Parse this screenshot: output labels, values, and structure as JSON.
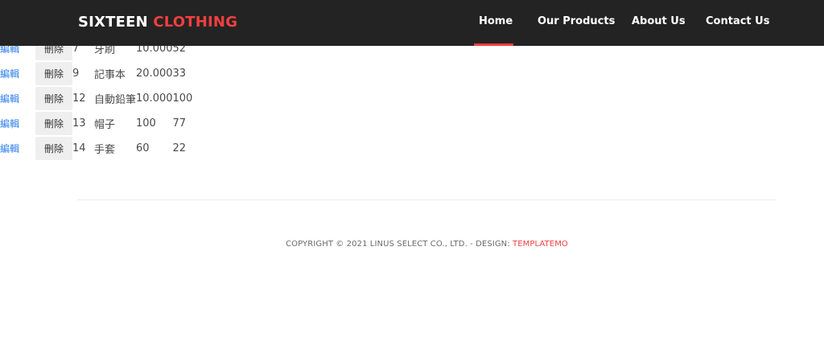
{
  "header": {
    "brand_part1": "SIXTEEN",
    "brand_part2": "CLOTHING",
    "nav": [
      {
        "label": "Home"
      },
      {
        "label": "Our Products"
      },
      {
        "label": "About Us"
      },
      {
        "label": "Contact Us"
      }
    ]
  },
  "table": {
    "edit_label": "編輯",
    "delete_label": "刪除",
    "rows": [
      {
        "id": "7",
        "name": "牙刷",
        "price": "10.000",
        "qty": "52"
      },
      {
        "id": "9",
        "name": "記事本",
        "price": "20.000",
        "qty": "33"
      },
      {
        "id": "12",
        "name": "自動鉛筆",
        "price": "10.000",
        "qty": "100"
      },
      {
        "id": "13",
        "name": "帽子",
        "price": "100",
        "qty": "77"
      },
      {
        "id": "14",
        "name": "手套",
        "price": "60",
        "qty": "22"
      }
    ]
  },
  "footer": {
    "copyright": "COPYRIGHT © 2021 LINUS SELECT CO., LTD. - DESIGN:",
    "design_link": "TEMPLATEMO"
  },
  "colors": {
    "header_bg": "#232323",
    "accent": "#f33f3f",
    "link": "#2f80ed"
  }
}
